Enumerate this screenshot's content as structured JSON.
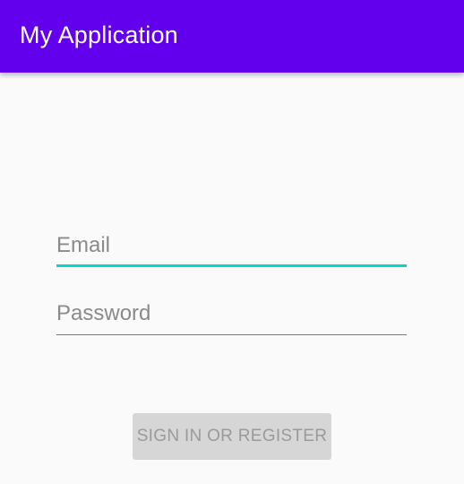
{
  "appbar": {
    "title": "My Application",
    "color": "#6200EE"
  },
  "form": {
    "email": {
      "value": "",
      "placeholder": "Email",
      "focused": true,
      "accent_color": "#03DAC5"
    },
    "password": {
      "value": "",
      "placeholder": "Password",
      "focused": false
    },
    "submit": {
      "label": "SIGN IN OR REGISTER",
      "enabled": false
    }
  }
}
